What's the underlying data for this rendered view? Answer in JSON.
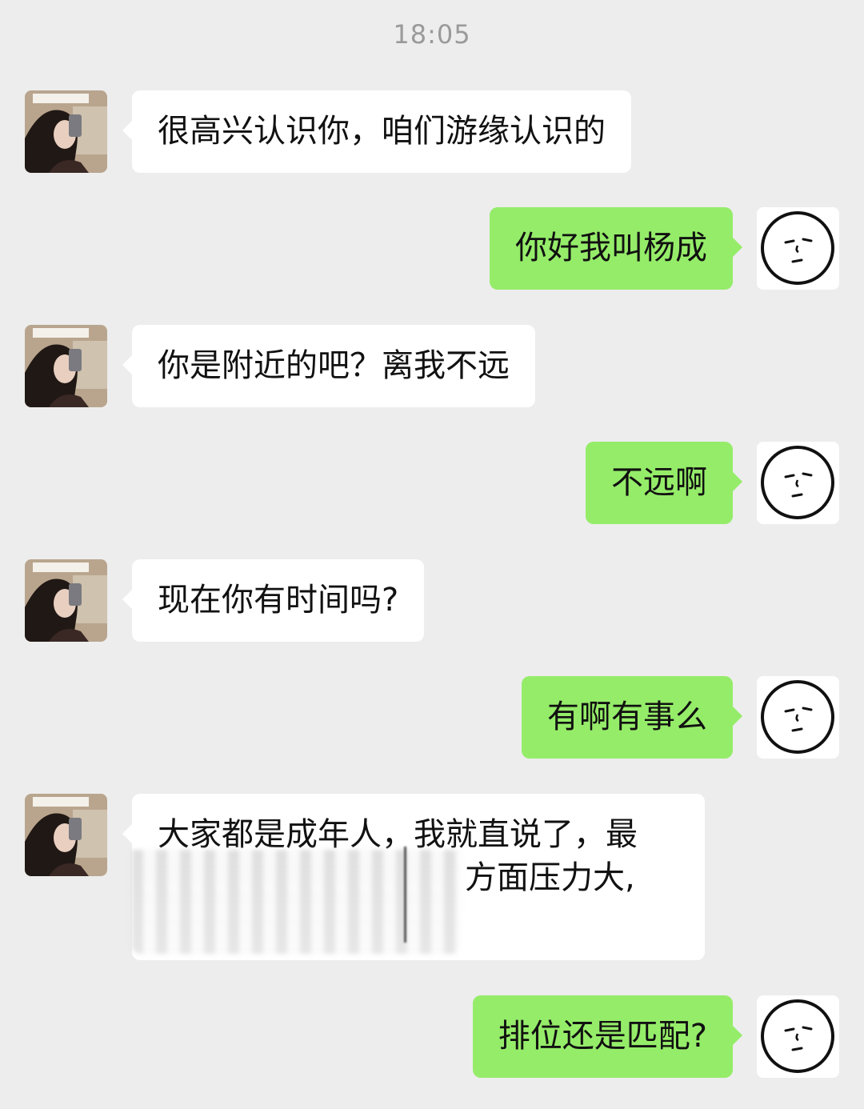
{
  "timestamp": "18:05",
  "messages": [
    {
      "side": "in",
      "text": "很高兴认识你，咱们游缘认识的"
    },
    {
      "side": "out",
      "text": "你好我叫杨成"
    },
    {
      "side": "in",
      "text": "你是附近的吧？离我不远"
    },
    {
      "side": "out",
      "text": "不远啊"
    },
    {
      "side": "in",
      "text": "现在你有时间吗?"
    },
    {
      "side": "out",
      "text": "有啊有事么"
    },
    {
      "side": "in",
      "line1": "大家都是成年人，我就直说了，最",
      "line2": "方面压力大,"
    },
    {
      "side": "out",
      "text": "排位还是匹配?"
    }
  ],
  "icons": {
    "contact_avatar": "woman-selfie-avatar",
    "self_avatar": "doodle-face-avatar"
  }
}
